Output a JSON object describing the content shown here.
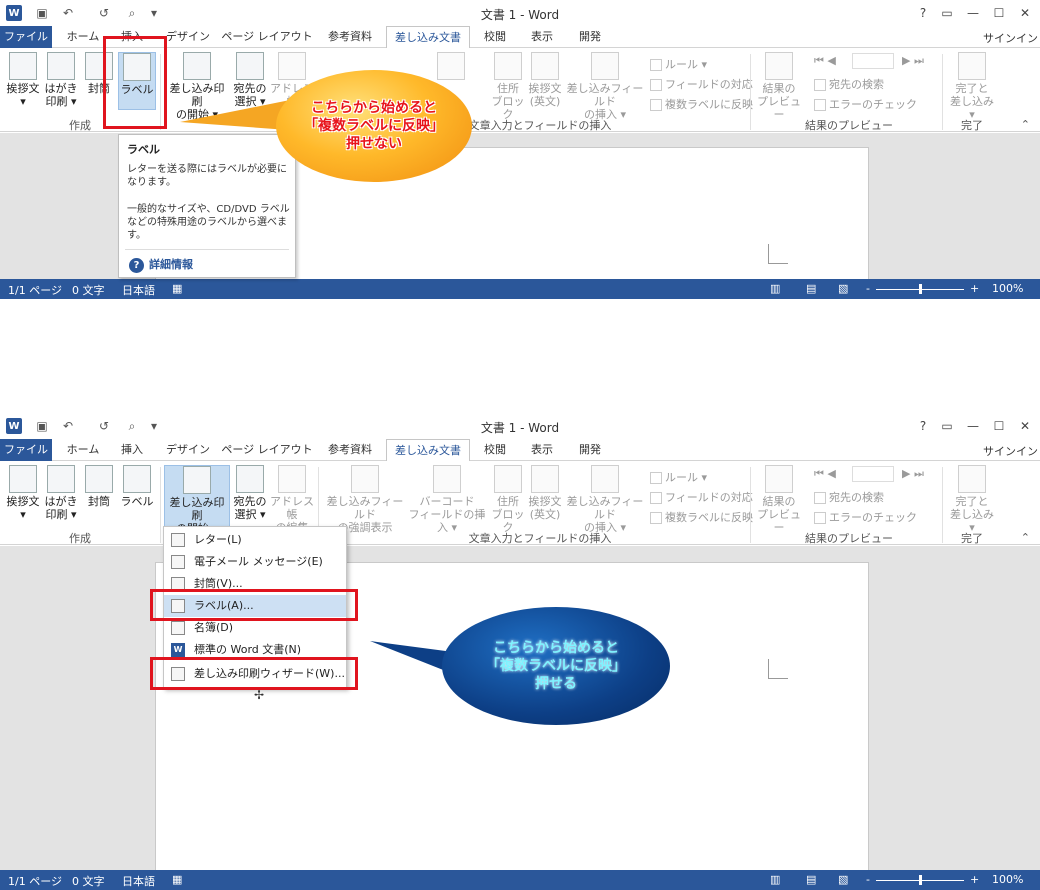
{
  "app": {
    "title": "文書 1 - Word",
    "signin": "サインイン",
    "win_help": "?",
    "quick_access": {
      "undo": "↶",
      "redo": "↺",
      "more": "▾"
    }
  },
  "tabs": [
    "ファイル",
    "ホーム",
    "挿入",
    "デザイン",
    "ページ レイアウト",
    "参考資料",
    "差し込み文書",
    "校閲",
    "表示",
    "開発"
  ],
  "ribbon": {
    "create": {
      "greeting": [
        "挨拶文",
        "▾"
      ],
      "postcard": [
        "はがき",
        "印刷 ▾"
      ],
      "envelope": "封筒",
      "label": "ラベル",
      "group": "作成"
    },
    "start": {
      "merge_start": [
        "差し込み印刷",
        "の開始 ▾"
      ],
      "select_recipients": [
        "宛先の",
        "選択 ▾"
      ],
      "edit_address": [
        "アドレス帳",
        "の編集"
      ]
    },
    "fields": {
      "highlight_fields": [
        "差し込みフィールド",
        "の強調表示"
      ],
      "barcode": [
        "バーコード",
        "フィールドの挿入 ▾"
      ],
      "address_block": [
        "住所",
        "ブロック"
      ],
      "greeting_en": [
        "挨拶文",
        "(英文)"
      ],
      "insert_field": [
        "差し込みフィールド",
        "の挿入 ▾"
      ],
      "rules": "ルール ▾",
      "match_fields": "フィールドの対応",
      "update_labels": "複数ラベルに反映",
      "group": "文章入力とフィールドの挿入"
    },
    "preview": {
      "preview_results": [
        "結果の",
        "プレビュー"
      ],
      "find_recipient": "宛先の検索",
      "check_errors": "エラーのチェック",
      "group": "結果のプレビュー"
    },
    "finish": {
      "finish_merge": [
        "完了と",
        "差し込み ▾"
      ],
      "group": "完了"
    },
    "collapse": "⌃"
  },
  "tooltip": {
    "title": "ラベル",
    "text1": "レターを送る際にはラベルが必要になります。",
    "text2": "一般的なサイズや、CD/DVD ラベルなどの特殊用途のラベルから選べます。",
    "help": "詳細情報"
  },
  "menu": {
    "items": [
      {
        "label": "レター(L)"
      },
      {
        "label": "電子メール メッセージ(E)"
      },
      {
        "label": "封筒(V)..."
      },
      {
        "label": "ラベル(A)..."
      },
      {
        "label": "名簿(D)"
      },
      {
        "label": "標準の Word 文書(N)"
      },
      {
        "label": "差し込み印刷ウィザード(W)..."
      }
    ]
  },
  "callouts": {
    "top": [
      "こちらから始めると",
      "「複数ラベルに反映」",
      "押せない"
    ],
    "bottom": [
      "こちらから始めると",
      "「複数ラベルに反映」",
      "押せる"
    ]
  },
  "status": {
    "page": "1/1 ページ",
    "words": "0 文字",
    "lang": "日本語",
    "zoom_minus": "-",
    "zoom_plus": "+",
    "zoom": "100%"
  },
  "colors": {
    "accent": "#2b579a",
    "highlight": "#e0141e",
    "orange_callout": "#f5a623",
    "blue_callout": "#0d3f86"
  }
}
